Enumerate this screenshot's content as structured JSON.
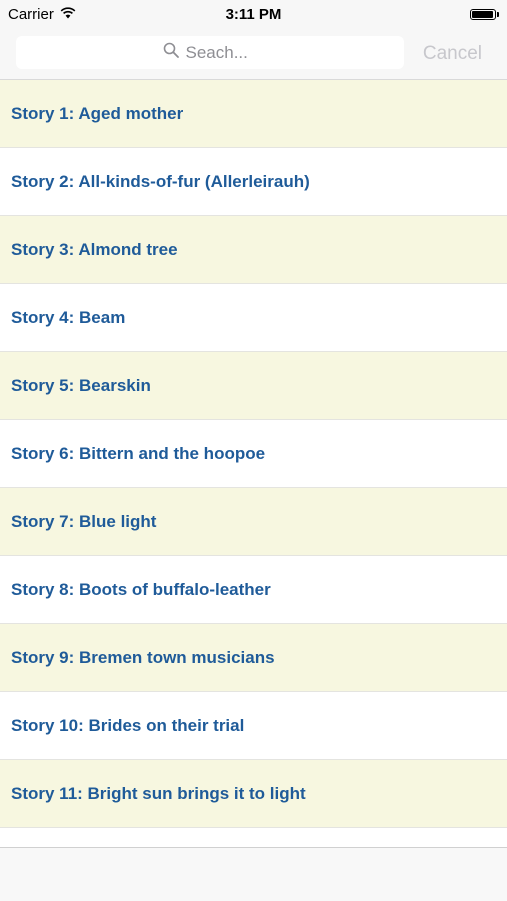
{
  "status_bar": {
    "carrier": "Carrier",
    "time": "3:11 PM",
    "wifi_icon": "wifi-icon",
    "battery_icon": "battery-icon",
    "battery_level": 0.95
  },
  "search": {
    "placeholder": "Seach...",
    "value": "",
    "icon": "search-icon",
    "cancel_label": "Cancel"
  },
  "stories": [
    {
      "label": "Story 1: Aged mother"
    },
    {
      "label": "Story 2: All-kinds-of-fur (Allerleirauh)"
    },
    {
      "label": "Story 3: Almond tree"
    },
    {
      "label": "Story 4: Beam"
    },
    {
      "label": "Story 5: Bearskin"
    },
    {
      "label": "Story 6: Bittern and the hoopoe"
    },
    {
      "label": "Story 7: Blue light"
    },
    {
      "label": "Story 8: Boots of buffalo-leather"
    },
    {
      "label": "Story 9: Bremen town musicians"
    },
    {
      "label": "Story 10: Brides on their trial"
    },
    {
      "label": "Story 11: Bright sun brings it to light"
    }
  ],
  "colors": {
    "alt_row_background": "#f7f7e0",
    "story_text": "#1f5b99",
    "bar_background": "#f7f7f7"
  }
}
